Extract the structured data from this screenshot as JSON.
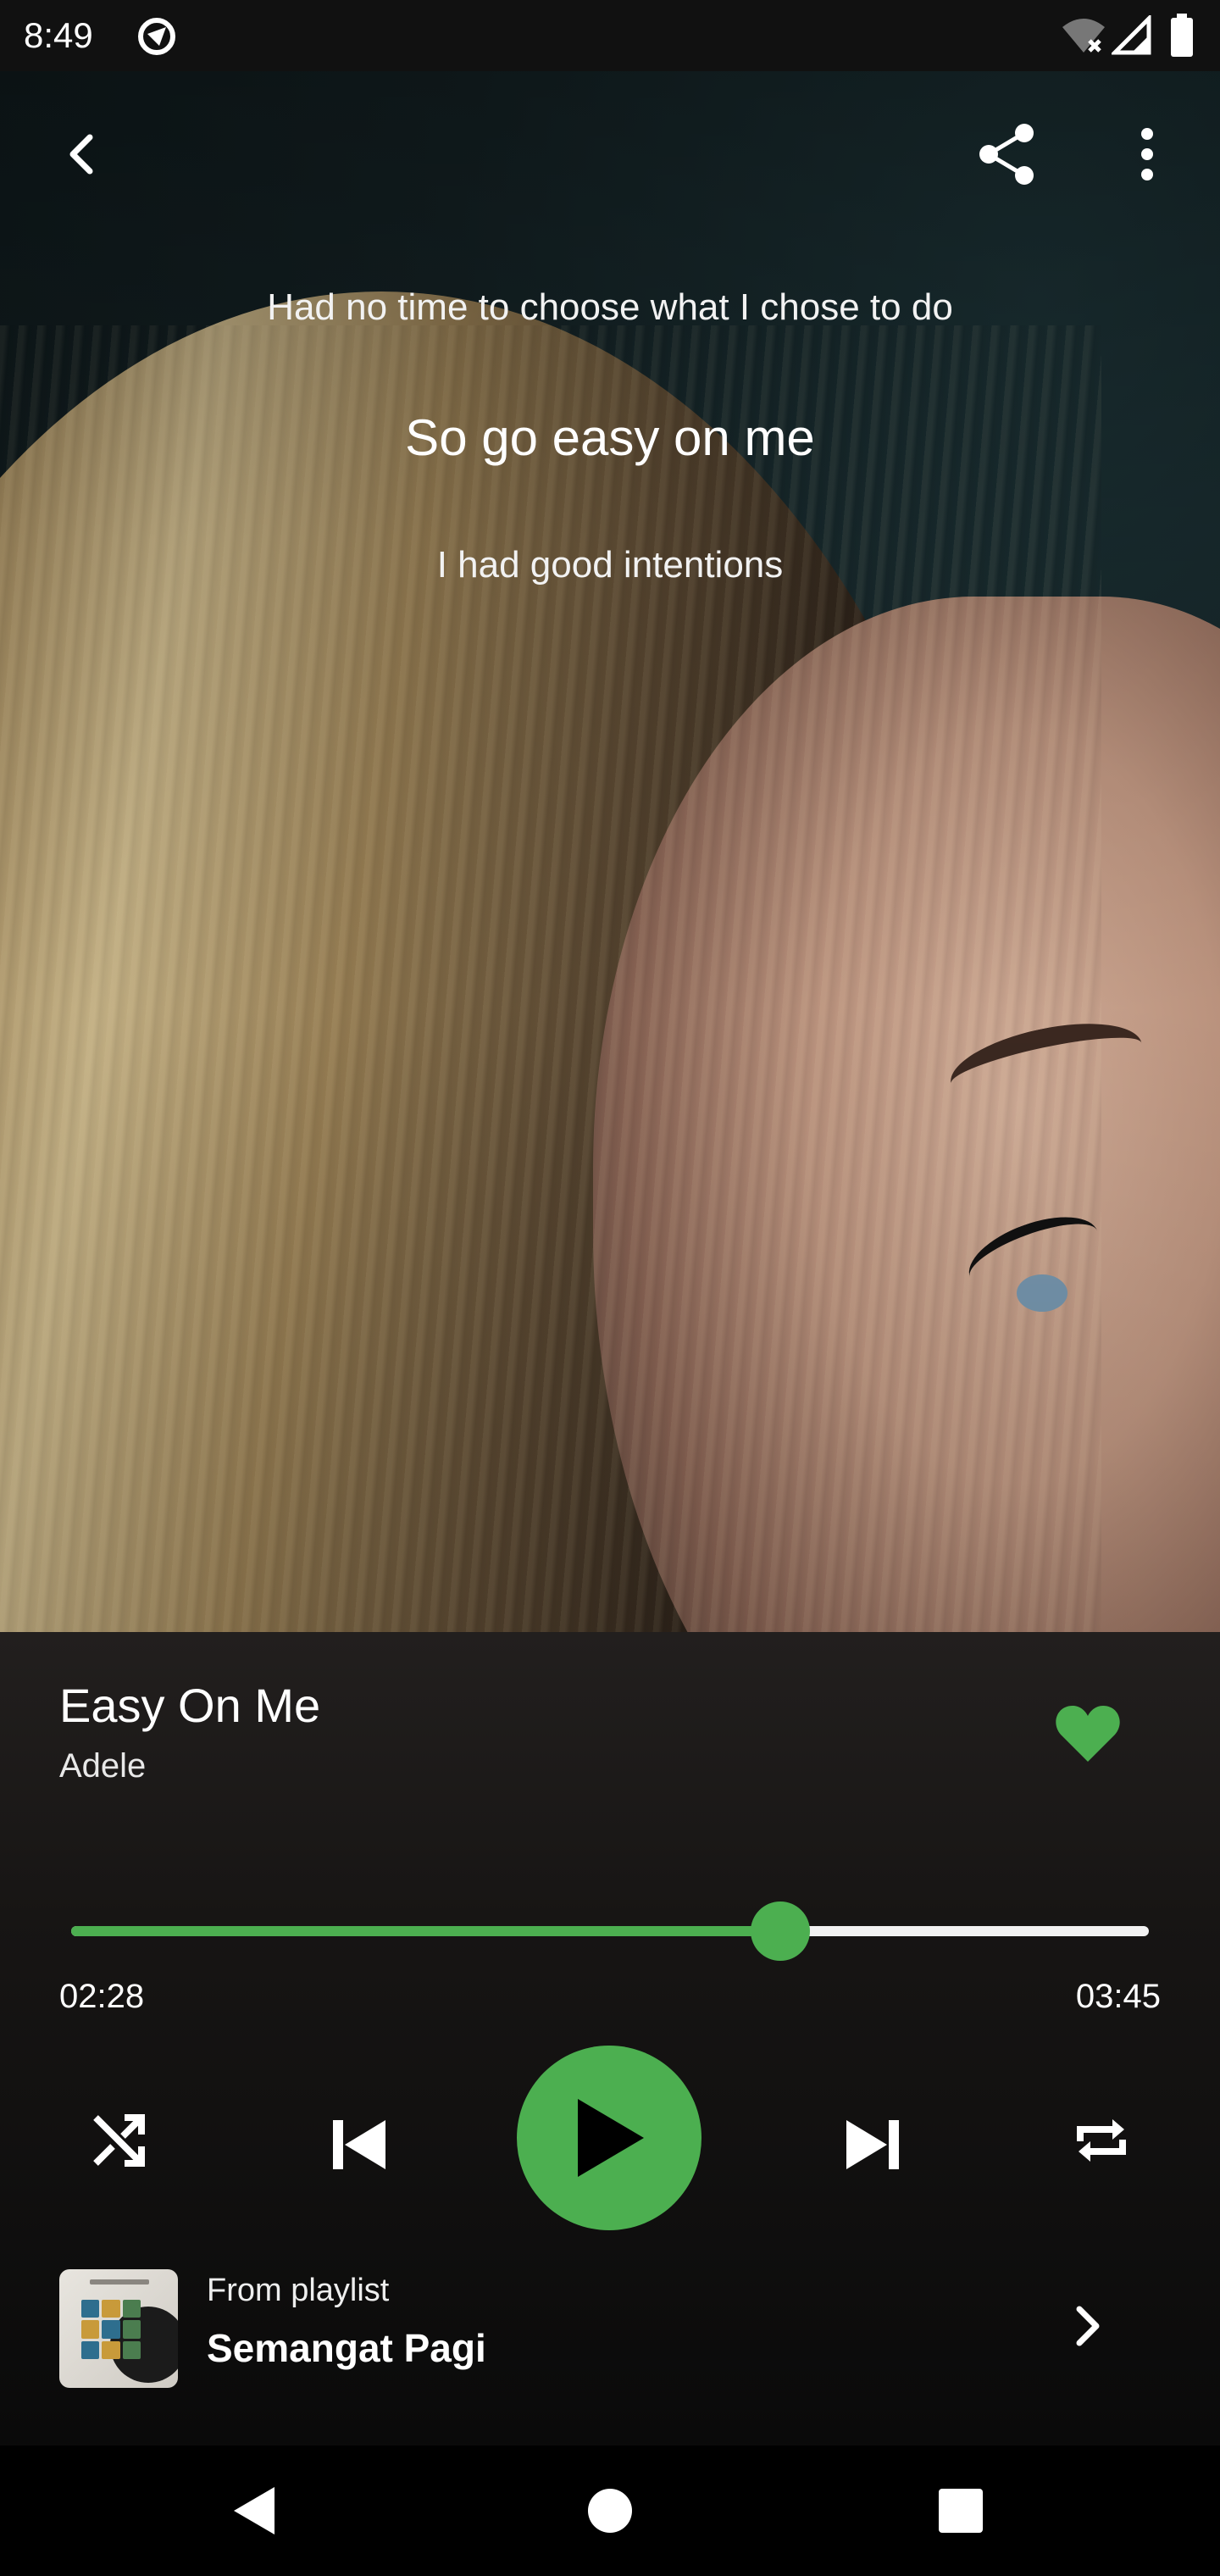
{
  "status_bar": {
    "time": "8:49",
    "icons": [
      "app-icon",
      "wifi-off-icon",
      "signal-icon",
      "battery-icon"
    ]
  },
  "lyrics": {
    "previous": "Had no time to choose what I chose to do",
    "current": "So go easy on me",
    "next": "I had good intentions"
  },
  "top_actions": [
    "back-icon",
    "share-icon",
    "more-vert-icon"
  ],
  "track": {
    "title": "Easy On Me",
    "artist": "Adele",
    "liked": true
  },
  "progress": {
    "current_time": "02:28",
    "total_time": "03:45",
    "fraction": 0.658
  },
  "controls": [
    "shuffle-icon",
    "skip-previous-icon",
    "play-icon",
    "skip-next-icon",
    "repeat-icon"
  ],
  "playlist": {
    "caption": "From playlist",
    "name": "Semangat Pagi"
  },
  "colors": {
    "accent": "#4caf50",
    "background": "#000000",
    "text": "#ffffff"
  },
  "nav_bar": [
    "nav-back-icon",
    "nav-home-icon",
    "nav-recents-icon"
  ]
}
